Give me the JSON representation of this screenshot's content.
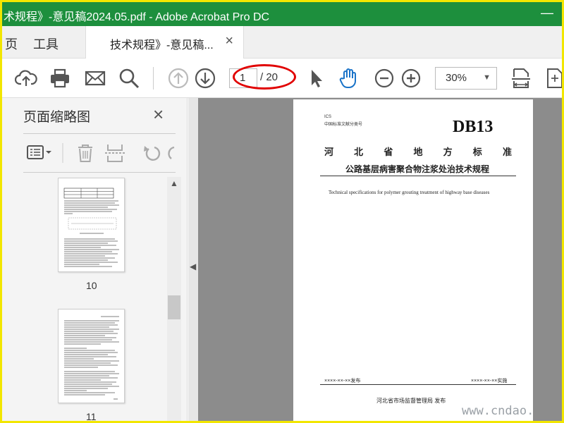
{
  "window": {
    "title": "术规程》-意见稿2024.05.pdf - Adobe Acrobat Pro DC",
    "controls": "—"
  },
  "tabs": {
    "home_partial": "页",
    "tools": "工具",
    "document": "技术规程》-意见稿...",
    "close": "×"
  },
  "toolbar": {
    "page_current": "1",
    "page_total": "/ 20",
    "zoom": "30%"
  },
  "left_panel": {
    "title": "页面缩略图",
    "close": "×",
    "thumbnails": [
      {
        "label": "10"
      },
      {
        "label": "11"
      }
    ]
  },
  "document_page": {
    "ics": "ICS",
    "classification": "中国标准文献分类号",
    "standard_code": "DB13",
    "province_chars": [
      "河",
      "北",
      "省",
      "地",
      "方",
      "标",
      "准"
    ],
    "title_cn": "公路基层病害聚合物注浆处治技术规程",
    "title_en": "Technical specifications for polymer grouting treatment of highway base diseases",
    "issue_date": "××××-××-××发布",
    "implement_date": "××××-××-××实施",
    "authority": "河北省市场监督管理局    发布"
  },
  "watermark": "www.cndao."
}
